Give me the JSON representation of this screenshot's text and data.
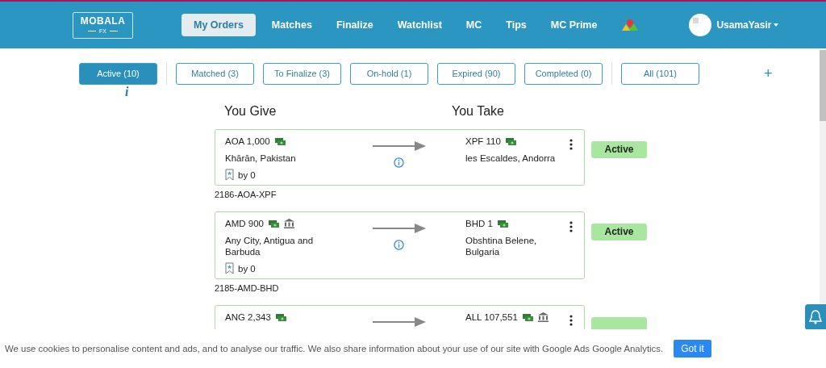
{
  "logo": {
    "name": "MOBALA",
    "sub": "FX"
  },
  "nav": [
    {
      "label": "My Orders",
      "selected": true
    },
    {
      "label": "Matches",
      "selected": false
    },
    {
      "label": "Finalize",
      "selected": false
    },
    {
      "label": "Watchlist",
      "selected": false
    },
    {
      "label": "MC",
      "selected": false
    },
    {
      "label": "Tips",
      "selected": false
    },
    {
      "label": "MC Prime",
      "selected": false
    }
  ],
  "user": {
    "name": "UsamaYasir"
  },
  "filters": [
    {
      "label": "Active (10)",
      "selected": true
    },
    {
      "label": "Matched (3)",
      "selected": false
    },
    {
      "label": "To Finalize (3)",
      "selected": false
    },
    {
      "label": "On-hold (1)",
      "selected": false
    },
    {
      "label": "Expired (90)",
      "selected": false
    },
    {
      "label": "Completed (0)",
      "selected": false
    },
    {
      "label": "All (101)",
      "selected": false
    }
  ],
  "add_button": "+",
  "info_mark": "i",
  "columns": [
    "You Give",
    "You Take"
  ],
  "orders": [
    {
      "give": {
        "amount": "AOA 1,000",
        "methods": [
          {
            "kind": "cash"
          }
        ],
        "location": "Khārān, Pakistan"
      },
      "take": {
        "amount": "XPF 110",
        "methods": [
          {
            "kind": "cash"
          }
        ],
        "location": "les Escaldes, Andorra"
      },
      "endorsed": "by 0",
      "id": "2186-AOA-XPF",
      "status": "Active"
    },
    {
      "give": {
        "amount": "AMD 900",
        "methods": [
          {
            "kind": "cash"
          },
          {
            "kind": "bank"
          }
        ],
        "location": "Any City, Antigua and Barbuda"
      },
      "take": {
        "amount": "BHD 1",
        "methods": [
          {
            "kind": "cash"
          }
        ],
        "location": "Obshtina Belene, Bulgaria"
      },
      "endorsed": "by 0",
      "id": "2185-AMD-BHD",
      "status": "Active"
    },
    {
      "give": {
        "amount": "ANG 2,343",
        "methods": [
          {
            "kind": "cash"
          }
        ]
      },
      "take": {
        "amount": "ALL 107,551",
        "methods": [
          {
            "kind": "cash"
          },
          {
            "kind": "bank"
          }
        ]
      }
    }
  ],
  "cookie": {
    "text": "We use cookies to personalise content and ads, and to analyse our traffic. We also share information about your use of our site with Google Ads Google Analytics.",
    "button": "Got it"
  }
}
